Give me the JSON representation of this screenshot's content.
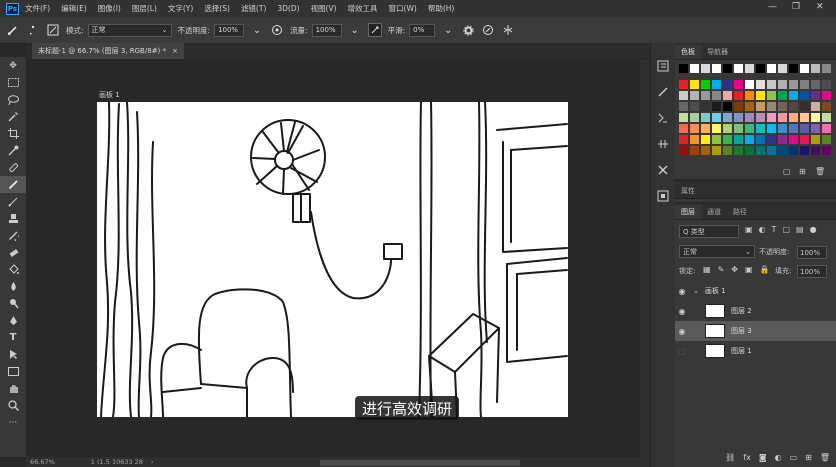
{
  "menubar": {
    "logo": "Ps",
    "items": [
      "文件(F)",
      "编辑(E)",
      "图像(I)",
      "图层(L)",
      "文字(Y)",
      "选择(S)",
      "滤镜(T)",
      "3D(D)",
      "视图(V)",
      "增效工具",
      "窗口(W)",
      "帮助(H)"
    ],
    "window_controls": [
      "—",
      "❐",
      "✕"
    ]
  },
  "options": {
    "mode_label": "模式:",
    "mode_value": "正常",
    "opacity_label": "不透明度:",
    "opacity_value": "100%",
    "flow_label": "流量:",
    "flow_value": "100%",
    "smooth_label": "平滑:",
    "smooth_value": "0%"
  },
  "document": {
    "tab_title": "未标题-1 @ 66.7% (图层 3, RGB/8#) *",
    "tab_close": "×",
    "artboard_label": "画板 1"
  },
  "status": {
    "zoom": "66.67%",
    "size": "1 (1.5 10633 28"
  },
  "subtitle": "进行高效调研",
  "swatches_panel": {
    "tabs": [
      "色板",
      "导航器"
    ],
    "colors": {
      "row1": [
        "#000000",
        "#ffffff",
        "#d8d8d8",
        "#ffffff",
        "#000000",
        "#ffffff",
        "#d8d8d8",
        "#000000",
        "#ffffff",
        "#d8d8d8",
        "#000000",
        "#ffffff",
        "#bbbbbb",
        "#888888"
      ],
      "row2": [
        "#ee1c24",
        "#ffe600",
        "#00d100",
        "#00aeef",
        "#2e3192",
        "#ec008c",
        "#ffffff",
        "#e0e0e0",
        "#c8c8c8",
        "#b0b0b0",
        "#999999",
        "#808080",
        "#666666",
        "#4d4d4d"
      ],
      "row3": [
        "#cccccc",
        "#b3b3b3",
        "#999999",
        "#888888",
        "#f2a7a7",
        "#ee1c24",
        "#ff8800",
        "#ffe600",
        "#8dc63f",
        "#00a651",
        "#00aeef",
        "#0054a6",
        "#662d91",
        "#ec008c"
      ],
      "row4": [
        "#666666",
        "#4d4d4d",
        "#333333",
        "#1a1a1a",
        "#000000",
        "#7d3a00",
        "#a4630e",
        "#c69c6d",
        "#998675",
        "#736357",
        "#534741",
        "#362f2d",
        "#c7b299",
        "#754c24"
      ],
      "row5": [
        "#c4df9b",
        "#a3d39c",
        "#7accc8",
        "#6dcff6",
        "#7da7d9",
        "#8393ca",
        "#a187be",
        "#bd8cbf",
        "#f49ac1",
        "#f5989d",
        "#f9ad81",
        "#fdc68a",
        "#fff799",
        "#c4df9b"
      ],
      "row6": [
        "#f26c4f",
        "#f68e56",
        "#fbaf5d",
        "#fff568",
        "#acd373",
        "#7cc576",
        "#3bb878",
        "#1abbb4",
        "#00bff3",
        "#438ccb",
        "#5574b9",
        "#605ca8",
        "#855fa8",
        "#f06eaa"
      ],
      "row7": [
        "#ed1c24",
        "#f7941d",
        "#fff200",
        "#8dc63f",
        "#39b54a",
        "#00a99d",
        "#00aeef",
        "#0072bc",
        "#2e3192",
        "#92278f",
        "#ec008c",
        "#ed145b",
        "#aba000",
        "#598527"
      ],
      "row8": [
        "#9e0b0f",
        "#a0410d",
        "#a36209",
        "#aba000",
        "#598527",
        "#197b30",
        "#007236",
        "#00746b",
        "#0076a3",
        "#004a80",
        "#003471",
        "#1b1464",
        "#440e62",
        "#630460"
      ]
    }
  },
  "properties_panel": {
    "tabs": [
      "属性"
    ]
  },
  "layers_panel": {
    "tabs": [
      "图层",
      "通道",
      "路径"
    ],
    "filter_label": "Q 类型",
    "blend_mode": "正常",
    "opacity_label": "不透明度:",
    "opacity_value": "100%",
    "lock_label": "锁定:",
    "fill_label": "填充:",
    "fill_value": "100%",
    "group_name": "画板 1",
    "layers": [
      "图层 2",
      "图层 3",
      "图层 1"
    ]
  }
}
